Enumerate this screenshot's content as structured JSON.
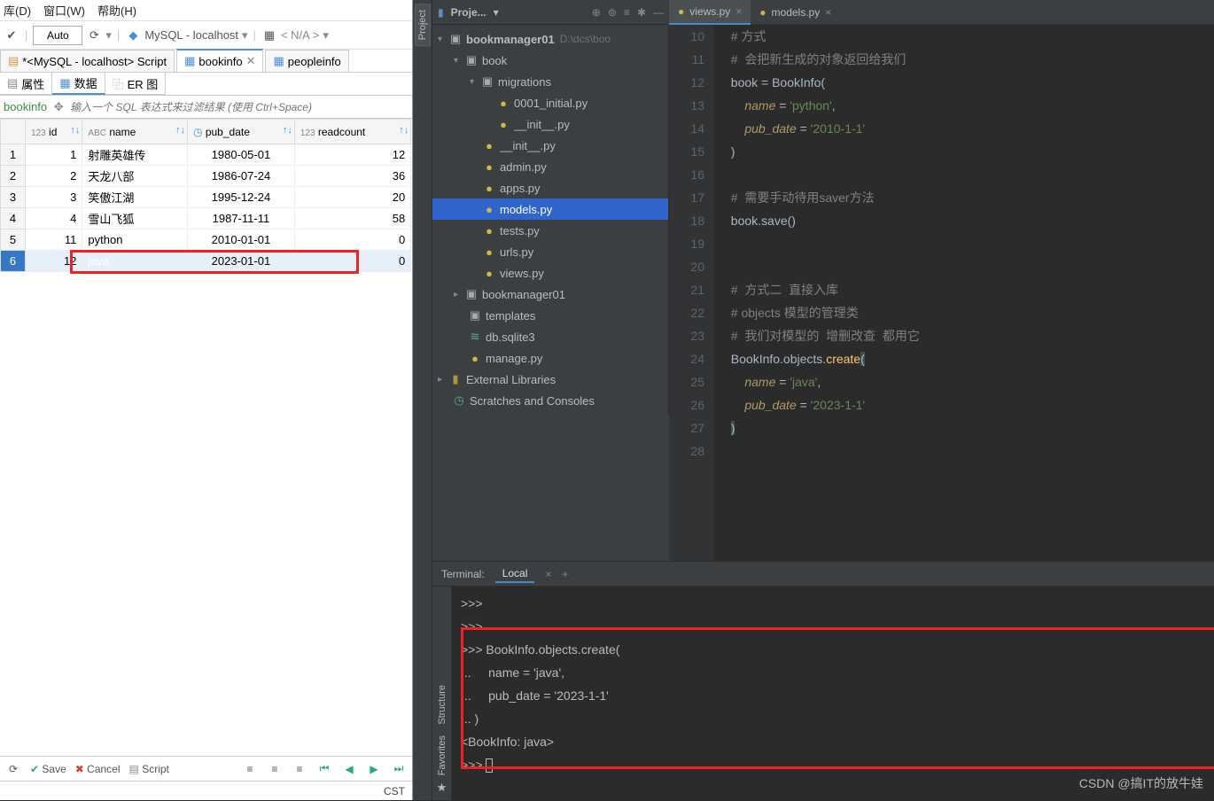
{
  "menu": {
    "db": "库(D)",
    "window": "窗口(W)",
    "help": "帮助(H)"
  },
  "toolbar": {
    "auto": "Auto",
    "datasource": "MySQL - localhost",
    "na": "< N/A >"
  },
  "script_tab": "*<MySQL - localhost> Script",
  "data_tabs": {
    "bookinfo": "bookinfo",
    "peopleinfo": "peopleinfo"
  },
  "subtabs": {
    "attrs": "属性",
    "data": "数据",
    "er": "ER 图"
  },
  "filter": {
    "table": "bookinfo",
    "placeholder": "输入一个 SQL 表达式来过滤结果 (使用 Ctrl+Space)"
  },
  "columns": {
    "id_pre": "123",
    "id": "id",
    "name_pre": "ABC",
    "name": "name",
    "date": "pub_date",
    "readcount_pre": "123",
    "readcount": "readcount"
  },
  "rows": [
    {
      "n": "1",
      "id": "1",
      "name": "射雕英雄传",
      "date": "1980-05-01",
      "rc": "12"
    },
    {
      "n": "2",
      "id": "2",
      "name": "天龙八部",
      "date": "1986-07-24",
      "rc": "36"
    },
    {
      "n": "3",
      "id": "3",
      "name": "笑傲江湖",
      "date": "1995-12-24",
      "rc": "20"
    },
    {
      "n": "4",
      "id": "4",
      "name": "雪山飞狐",
      "date": "1987-11-11",
      "rc": "58"
    },
    {
      "n": "5",
      "id": "11",
      "name": "python",
      "date": "2010-01-01",
      "rc": "0"
    },
    {
      "n": "6",
      "id": "12",
      "name": "java",
      "date": "2023-01-01",
      "rc": "0"
    }
  ],
  "bottom": {
    "save": "Save",
    "cancel": "Cancel",
    "script": "Script"
  },
  "status": "CST",
  "proj_label": "Proje...",
  "project_root": {
    "name": "bookmanager01",
    "hint": "D:\\dcs\\boo"
  },
  "tree": {
    "book": "book",
    "migrations": "migrations",
    "f_0001": "0001_initial.py",
    "f_init1": "__init__.py",
    "f_init2": "__init__.py",
    "f_admin": "admin.py",
    "f_apps": "apps.py",
    "f_models": "models.py",
    "f_tests": "tests.py",
    "f_urls": "urls.py",
    "f_views": "views.py",
    "bm01": "bookmanager01",
    "templates": "templates",
    "db": "db.sqlite3",
    "manage": "manage.py",
    "ext": "External Libraries",
    "scratch": "Scratches and Consoles"
  },
  "editor_tabs": {
    "views": "views.py",
    "models": "models.py"
  },
  "code": {
    "lines": [
      "10",
      "11",
      "12",
      "13",
      "14",
      "15",
      "16",
      "17",
      "18",
      "19",
      "20",
      "21",
      "22",
      "23",
      "24",
      "25",
      "26",
      "27",
      "28"
    ],
    "l10": "# 方式",
    "l11a": "#  会把新生成的对象返回给我们",
    "l12a": "book = BookInfo(",
    "l13a": "name",
    "l13b": "'python'",
    "l14a": "pub_date",
    "l14b": "'2010-1-1'",
    "l15": ")",
    "l17a": "#  需要手动待用saver方法",
    "l18a": "book.save()",
    "l21a": "#  方式二  直接入库",
    "l22a": "# objects 模型的管理类",
    "l23a": "#  我们对模型的  增删改查  都用它",
    "l24a": "BookInfo.objects.",
    "l24b": "create",
    "l25a": "name",
    "l25b": "'java'",
    "l26a": "pub_date",
    "l26b": "'2023-1-1'",
    "l27": ")"
  },
  "terminal": {
    "title": "Terminal:",
    "tab": "Local",
    "l1": ">>>",
    "l2": ">>>",
    "l3": ">>> BookInfo.objects.create(",
    "l4": "...     name = 'java',",
    "l5": "...     pub_date = '2023-1-1'",
    "l6": "... )",
    "l7": "<BookInfo: java>",
    "l8": ">>> "
  },
  "sidetabs": {
    "project": "Project",
    "structure": "Structure",
    "favorites": "Favorites"
  },
  "watermark": "CSDN @搞IT的放牛娃"
}
